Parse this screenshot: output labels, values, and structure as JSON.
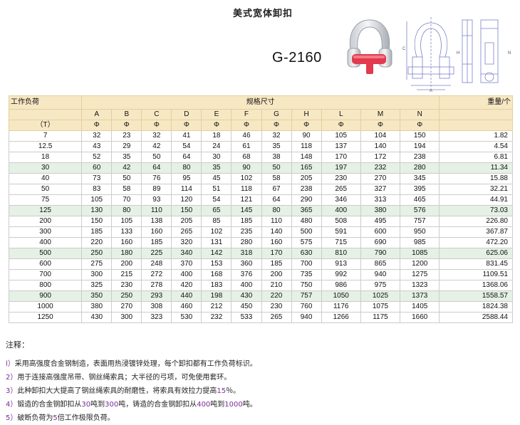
{
  "title": "美式宽体卸扣",
  "model": "G-2160",
  "header": {
    "load_label": "工作负荷",
    "spec_label": "规格尺寸",
    "weight_label": "重量/个",
    "unit": "（T）",
    "cols": [
      "A",
      "B",
      "C",
      "D",
      "E",
      "F",
      "G",
      "H",
      "L",
      "M",
      "N"
    ],
    "symbol": "Φ"
  },
  "rows": [
    [
      "7",
      "32",
      "23",
      "32",
      "41",
      "18",
      "46",
      "32",
      "90",
      "105",
      "104",
      "150",
      "1.82"
    ],
    [
      "12.5",
      "43",
      "29",
      "42",
      "54",
      "24",
      "61",
      "35",
      "118",
      "137",
      "140",
      "194",
      "4.54"
    ],
    [
      "18",
      "52",
      "35",
      "50",
      "64",
      "30",
      "68",
      "38",
      "148",
      "170",
      "172",
      "238",
      "6.81"
    ],
    [
      "30",
      "60",
      "42",
      "64",
      "80",
      "35",
      "90",
      "50",
      "165",
      "197",
      "232",
      "280",
      "11.34"
    ],
    [
      "40",
      "73",
      "50",
      "76",
      "95",
      "45",
      "102",
      "58",
      "205",
      "230",
      "270",
      "345",
      "15.88"
    ],
    [
      "50",
      "83",
      "58",
      "89",
      "114",
      "51",
      "118",
      "67",
      "238",
      "265",
      "327",
      "395",
      "32.21"
    ],
    [
      "75",
      "105",
      "70",
      "93",
      "120",
      "54",
      "121",
      "64",
      "290",
      "346",
      "313",
      "465",
      "44.91"
    ],
    [
      "125",
      "130",
      "80",
      "110",
      "150",
      "65",
      "145",
      "80",
      "365",
      "400",
      "380",
      "576",
      "73.03"
    ],
    [
      "200",
      "150",
      "105",
      "138",
      "205",
      "85",
      "185",
      "110",
      "480",
      "508",
      "495",
      "757",
      "226.80"
    ],
    [
      "300",
      "185",
      "133",
      "160",
      "265",
      "102",
      "235",
      "140",
      "500",
      "591",
      "600",
      "950",
      "367.87"
    ],
    [
      "400",
      "220",
      "160",
      "185",
      "320",
      "131",
      "280",
      "160",
      "575",
      "715",
      "690",
      "985",
      "472.20"
    ],
    [
      "500",
      "250",
      "180",
      "225",
      "340",
      "142",
      "318",
      "170",
      "630",
      "810",
      "790",
      "1085",
      "625.06"
    ],
    [
      "600",
      "275",
      "200",
      "248",
      "370",
      "153",
      "360",
      "185",
      "700",
      "913",
      "865",
      "1200",
      "831.45"
    ],
    [
      "700",
      "300",
      "215",
      "272",
      "400",
      "168",
      "376",
      "200",
      "735",
      "992",
      "940",
      "1275",
      "1109.51"
    ],
    [
      "800",
      "325",
      "230",
      "278",
      "420",
      "183",
      "400",
      "210",
      "750",
      "986",
      "975",
      "1323",
      "1368.06"
    ],
    [
      "900",
      "350",
      "250",
      "293",
      "440",
      "198",
      "430",
      "220",
      "757",
      "1050",
      "1025",
      "1373",
      "1558.57"
    ],
    [
      "1000",
      "380",
      "270",
      "308",
      "460",
      "212",
      "450",
      "230",
      "760",
      "1176",
      "1075",
      "1405",
      "1824.38"
    ],
    [
      "1250",
      "430",
      "300",
      "323",
      "530",
      "232",
      "533",
      "265",
      "940",
      "1266",
      "1175",
      "1660",
      "2588.44"
    ]
  ],
  "notes": {
    "title": "注释：",
    "items": [
      {
        "idx": "l）",
        "parts": [
          "采用高强度合金钢制造，表面用热浸镀锌处理，每个卸扣都有工作负荷标识。"
        ]
      },
      {
        "idx": "2）",
        "parts": [
          "用于连接高强度吊带、钢丝绳索具；大半径的弓项，可免使用套环。"
        ]
      },
      {
        "idx": "3）",
        "parts": [
          "此种卸扣大大提高了钢丝绳索具的耐磨性，将索具有效拉力提高",
          "15",
          "％。"
        ]
      },
      {
        "idx": "4）",
        "parts": [
          "锻造的合金钢卸扣从",
          "30",
          "吨到",
          "300",
          "吨，铸造的合金钢卸扣从",
          "400",
          "吨到",
          "1000",
          "吨。"
        ]
      },
      {
        "idx": "5）",
        "parts": [
          "破断负荷为",
          "5",
          "倍工作极限负荷。"
        ]
      }
    ]
  },
  "colors": {
    "header_bg": "#f7e8c4",
    "row_shade": "#e4f1e4",
    "note_number": "#7b2b9a",
    "shackle_red": "#e23a4e"
  }
}
